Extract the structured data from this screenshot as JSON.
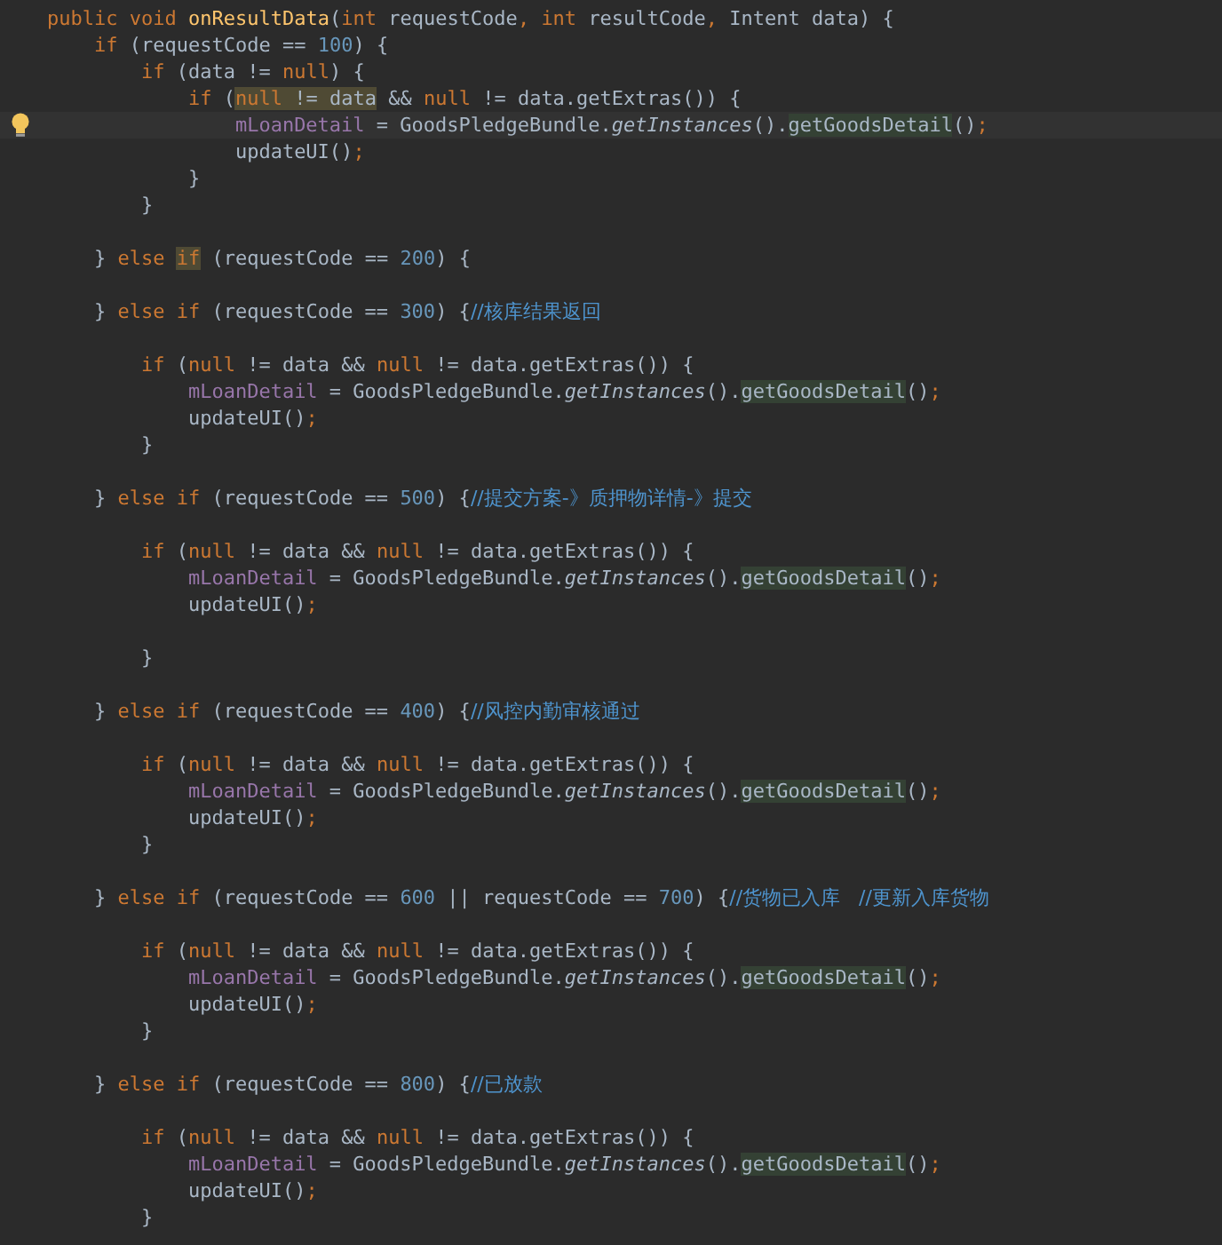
{
  "lines": [
    {
      "current": false,
      "tokens": [
        {
          "text": "    public void ",
          "kind": "keyword"
        },
        {
          "text": "onResultData",
          "kind": "declaration"
        },
        {
          "text": "(",
          "kind": "plain"
        },
        {
          "text": "int ",
          "kind": "keyword"
        },
        {
          "text": "requestCode",
          "kind": "plain"
        },
        {
          "text": ", ",
          "kind": "punct"
        },
        {
          "text": "int ",
          "kind": "keyword"
        },
        {
          "text": "resultCode",
          "kind": "plain"
        },
        {
          "text": ", ",
          "kind": "punct"
        },
        {
          "text": "Intent data) {",
          "kind": "plain"
        }
      ]
    },
    {
      "current": false,
      "tokens": [
        {
          "text": "        if ",
          "kind": "keyword"
        },
        {
          "text": "(requestCode == ",
          "kind": "plain"
        },
        {
          "text": "100",
          "kind": "number"
        },
        {
          "text": ") {",
          "kind": "plain"
        }
      ]
    },
    {
      "current": false,
      "tokens": [
        {
          "text": "            if ",
          "kind": "keyword"
        },
        {
          "text": "(data != ",
          "kind": "plain"
        },
        {
          "text": "null",
          "kind": "keyword"
        },
        {
          "text": ") {",
          "kind": "plain"
        }
      ]
    },
    {
      "current": false,
      "tokens": [
        {
          "text": "                if ",
          "kind": "keyword"
        },
        {
          "text": "(",
          "kind": "plain"
        },
        {
          "text": "null",
          "kind": "keyword-usage"
        },
        {
          "text": " != data",
          "kind": "plain-usage"
        },
        {
          "text": " && ",
          "kind": "plain"
        },
        {
          "text": "null",
          "kind": "keyword"
        },
        {
          "text": " != data.getExtras()) {",
          "kind": "plain"
        }
      ]
    },
    {
      "current": true,
      "tokens": [
        {
          "text": "                    mLoanDetail",
          "kind": "field"
        },
        {
          "text": " = GoodsPledgeBundle.",
          "kind": "plain"
        },
        {
          "text": "getInstances",
          "kind": "static"
        },
        {
          "text": "().",
          "kind": "plain"
        },
        {
          "text": "getGoodsDetail",
          "kind": "reference"
        },
        {
          "text": "()",
          "kind": "plain"
        },
        {
          "text": ";",
          "kind": "punct"
        }
      ]
    },
    {
      "current": false,
      "tokens": [
        {
          "text": "                    updateUI()",
          "kind": "plain"
        },
        {
          "text": ";",
          "kind": "punct"
        }
      ]
    },
    {
      "current": false,
      "tokens": [
        {
          "text": "                }",
          "kind": "plain"
        }
      ]
    },
    {
      "current": false,
      "tokens": [
        {
          "text": "            }",
          "kind": "plain"
        }
      ]
    },
    {
      "current": false
    },
    {
      "current": false,
      "tokens": [
        {
          "text": "        } ",
          "kind": "plain"
        },
        {
          "text": "else ",
          "kind": "keyword"
        },
        {
          "text": "if",
          "kind": "keyword-usage"
        },
        {
          "text": " (requestCode == ",
          "kind": "plain"
        },
        {
          "text": "200",
          "kind": "number"
        },
        {
          "text": ") {",
          "kind": "plain"
        }
      ]
    },
    {
      "current": false
    },
    {
      "current": false,
      "tokens": [
        {
          "text": "        } ",
          "kind": "plain"
        },
        {
          "text": "else if ",
          "kind": "keyword"
        },
        {
          "text": "(requestCode == ",
          "kind": "plain"
        },
        {
          "text": "300",
          "kind": "number"
        },
        {
          "text": ") {",
          "kind": "plain"
        },
        {
          "text": "//核库结果返回",
          "kind": "comment"
        }
      ]
    },
    {
      "current": false
    },
    {
      "current": false,
      "tokens": [
        {
          "text": "            if ",
          "kind": "keyword"
        },
        {
          "text": "(",
          "kind": "plain"
        },
        {
          "text": "null",
          "kind": "keyword"
        },
        {
          "text": " != data && ",
          "kind": "plain"
        },
        {
          "text": "null",
          "kind": "keyword"
        },
        {
          "text": " != data.getExtras()) {",
          "kind": "plain"
        }
      ]
    },
    {
      "current": false,
      "tokens": [
        {
          "text": "                mLoanDetail",
          "kind": "field"
        },
        {
          "text": " = GoodsPledgeBundle.",
          "kind": "plain"
        },
        {
          "text": "getInstances",
          "kind": "static"
        },
        {
          "text": "().",
          "kind": "plain"
        },
        {
          "text": "getGoodsDetail",
          "kind": "reference"
        },
        {
          "text": "()",
          "kind": "plain"
        },
        {
          "text": ";",
          "kind": "punct"
        }
      ]
    },
    {
      "current": false,
      "tokens": [
        {
          "text": "                updateUI()",
          "kind": "plain"
        },
        {
          "text": ";",
          "kind": "punct"
        }
      ]
    },
    {
      "current": false,
      "tokens": [
        {
          "text": "            }",
          "kind": "plain"
        }
      ]
    },
    {
      "current": false
    },
    {
      "current": false,
      "tokens": [
        {
          "text": "        } ",
          "kind": "plain"
        },
        {
          "text": "else if ",
          "kind": "keyword"
        },
        {
          "text": "(requestCode == ",
          "kind": "plain"
        },
        {
          "text": "500",
          "kind": "number"
        },
        {
          "text": ") {",
          "kind": "plain"
        },
        {
          "text": "//提交方案-》质押物详情-》提交",
          "kind": "comment"
        }
      ]
    },
    {
      "current": false
    },
    {
      "current": false,
      "tokens": [
        {
          "text": "            if ",
          "kind": "keyword"
        },
        {
          "text": "(",
          "kind": "plain"
        },
        {
          "text": "null",
          "kind": "keyword"
        },
        {
          "text": " != data && ",
          "kind": "plain"
        },
        {
          "text": "null",
          "kind": "keyword"
        },
        {
          "text": " != data.getExtras()) {",
          "kind": "plain"
        }
      ]
    },
    {
      "current": false,
      "tokens": [
        {
          "text": "                mLoanDetail",
          "kind": "field"
        },
        {
          "text": " = GoodsPledgeBundle.",
          "kind": "plain"
        },
        {
          "text": "getInstances",
          "kind": "static"
        },
        {
          "text": "().",
          "kind": "plain"
        },
        {
          "text": "getGoodsDetail",
          "kind": "reference"
        },
        {
          "text": "()",
          "kind": "plain"
        },
        {
          "text": ";",
          "kind": "punct"
        }
      ]
    },
    {
      "current": false,
      "tokens": [
        {
          "text": "                updateUI()",
          "kind": "plain"
        },
        {
          "text": ";",
          "kind": "punct"
        }
      ]
    },
    {
      "current": false
    },
    {
      "current": false,
      "tokens": [
        {
          "text": "            }",
          "kind": "plain"
        }
      ]
    },
    {
      "current": false
    },
    {
      "current": false,
      "tokens": [
        {
          "text": "        } ",
          "kind": "plain"
        },
        {
          "text": "else if ",
          "kind": "keyword"
        },
        {
          "text": "(requestCode == ",
          "kind": "plain"
        },
        {
          "text": "400",
          "kind": "number"
        },
        {
          "text": ") {",
          "kind": "plain"
        },
        {
          "text": "//风控内勤审核通过",
          "kind": "comment"
        }
      ]
    },
    {
      "current": false
    },
    {
      "current": false,
      "tokens": [
        {
          "text": "            if ",
          "kind": "keyword"
        },
        {
          "text": "(",
          "kind": "plain"
        },
        {
          "text": "null",
          "kind": "keyword"
        },
        {
          "text": " != data && ",
          "kind": "plain"
        },
        {
          "text": "null",
          "kind": "keyword"
        },
        {
          "text": " != data.getExtras()) {",
          "kind": "plain"
        }
      ]
    },
    {
      "current": false,
      "tokens": [
        {
          "text": "                mLoanDetail",
          "kind": "field"
        },
        {
          "text": " = GoodsPledgeBundle.",
          "kind": "plain"
        },
        {
          "text": "getInstances",
          "kind": "static"
        },
        {
          "text": "().",
          "kind": "plain"
        },
        {
          "text": "getGoodsDetail",
          "kind": "reference"
        },
        {
          "text": "()",
          "kind": "plain"
        },
        {
          "text": ";",
          "kind": "punct"
        }
      ]
    },
    {
      "current": false,
      "tokens": [
        {
          "text": "                updateUI()",
          "kind": "plain"
        },
        {
          "text": ";",
          "kind": "punct"
        }
      ]
    },
    {
      "current": false,
      "tokens": [
        {
          "text": "            }",
          "kind": "plain"
        }
      ]
    },
    {
      "current": false
    },
    {
      "current": false,
      "tokens": [
        {
          "text": "        } ",
          "kind": "plain"
        },
        {
          "text": "else if ",
          "kind": "keyword"
        },
        {
          "text": "(requestCode == ",
          "kind": "plain"
        },
        {
          "text": "600",
          "kind": "number"
        },
        {
          "text": " || requestCode == ",
          "kind": "plain"
        },
        {
          "text": "700",
          "kind": "number"
        },
        {
          "text": ") {",
          "kind": "plain"
        },
        {
          "text": "//货物已入库   //更新入库货物",
          "kind": "comment"
        }
      ]
    },
    {
      "current": false
    },
    {
      "current": false,
      "tokens": [
        {
          "text": "            if ",
          "kind": "keyword"
        },
        {
          "text": "(",
          "kind": "plain"
        },
        {
          "text": "null",
          "kind": "keyword"
        },
        {
          "text": " != data && ",
          "kind": "plain"
        },
        {
          "text": "null",
          "kind": "keyword"
        },
        {
          "text": " != data.getExtras()) {",
          "kind": "plain"
        }
      ]
    },
    {
      "current": false,
      "tokens": [
        {
          "text": "                mLoanDetail",
          "kind": "field"
        },
        {
          "text": " = GoodsPledgeBundle.",
          "kind": "plain"
        },
        {
          "text": "getInstances",
          "kind": "static"
        },
        {
          "text": "().",
          "kind": "plain"
        },
        {
          "text": "getGoodsDetail",
          "kind": "reference"
        },
        {
          "text": "()",
          "kind": "plain"
        },
        {
          "text": ";",
          "kind": "punct"
        }
      ]
    },
    {
      "current": false,
      "tokens": [
        {
          "text": "                updateUI()",
          "kind": "plain"
        },
        {
          "text": ";",
          "kind": "punct"
        }
      ]
    },
    {
      "current": false,
      "tokens": [
        {
          "text": "            }",
          "kind": "plain"
        }
      ]
    },
    {
      "current": false
    },
    {
      "current": false,
      "tokens": [
        {
          "text": "        } ",
          "kind": "plain"
        },
        {
          "text": "else if ",
          "kind": "keyword"
        },
        {
          "text": "(requestCode == ",
          "kind": "plain"
        },
        {
          "text": "800",
          "kind": "number"
        },
        {
          "text": ") {",
          "kind": "plain"
        },
        {
          "text": "//已放款",
          "kind": "comment"
        }
      ]
    },
    {
      "current": false
    },
    {
      "current": false,
      "tokens": [
        {
          "text": "            if ",
          "kind": "keyword"
        },
        {
          "text": "(",
          "kind": "plain"
        },
        {
          "text": "null",
          "kind": "keyword"
        },
        {
          "text": " != data && ",
          "kind": "plain"
        },
        {
          "text": "null",
          "kind": "keyword"
        },
        {
          "text": " != data.getExtras()) {",
          "kind": "plain"
        }
      ]
    },
    {
      "current": false,
      "tokens": [
        {
          "text": "                mLoanDetail",
          "kind": "field"
        },
        {
          "text": " = GoodsPledgeBundle.",
          "kind": "plain"
        },
        {
          "text": "getInstances",
          "kind": "static"
        },
        {
          "text": "().",
          "kind": "plain"
        },
        {
          "text": "getGoodsDetail",
          "kind": "reference"
        },
        {
          "text": "()",
          "kind": "plain"
        },
        {
          "text": ";",
          "kind": "punct"
        }
      ]
    },
    {
      "current": false,
      "tokens": [
        {
          "text": "                updateUI()",
          "kind": "plain"
        },
        {
          "text": ";",
          "kind": "punct"
        }
      ]
    },
    {
      "current": false,
      "tokens": [
        {
          "text": "            }",
          "kind": "plain"
        }
      ]
    }
  ]
}
